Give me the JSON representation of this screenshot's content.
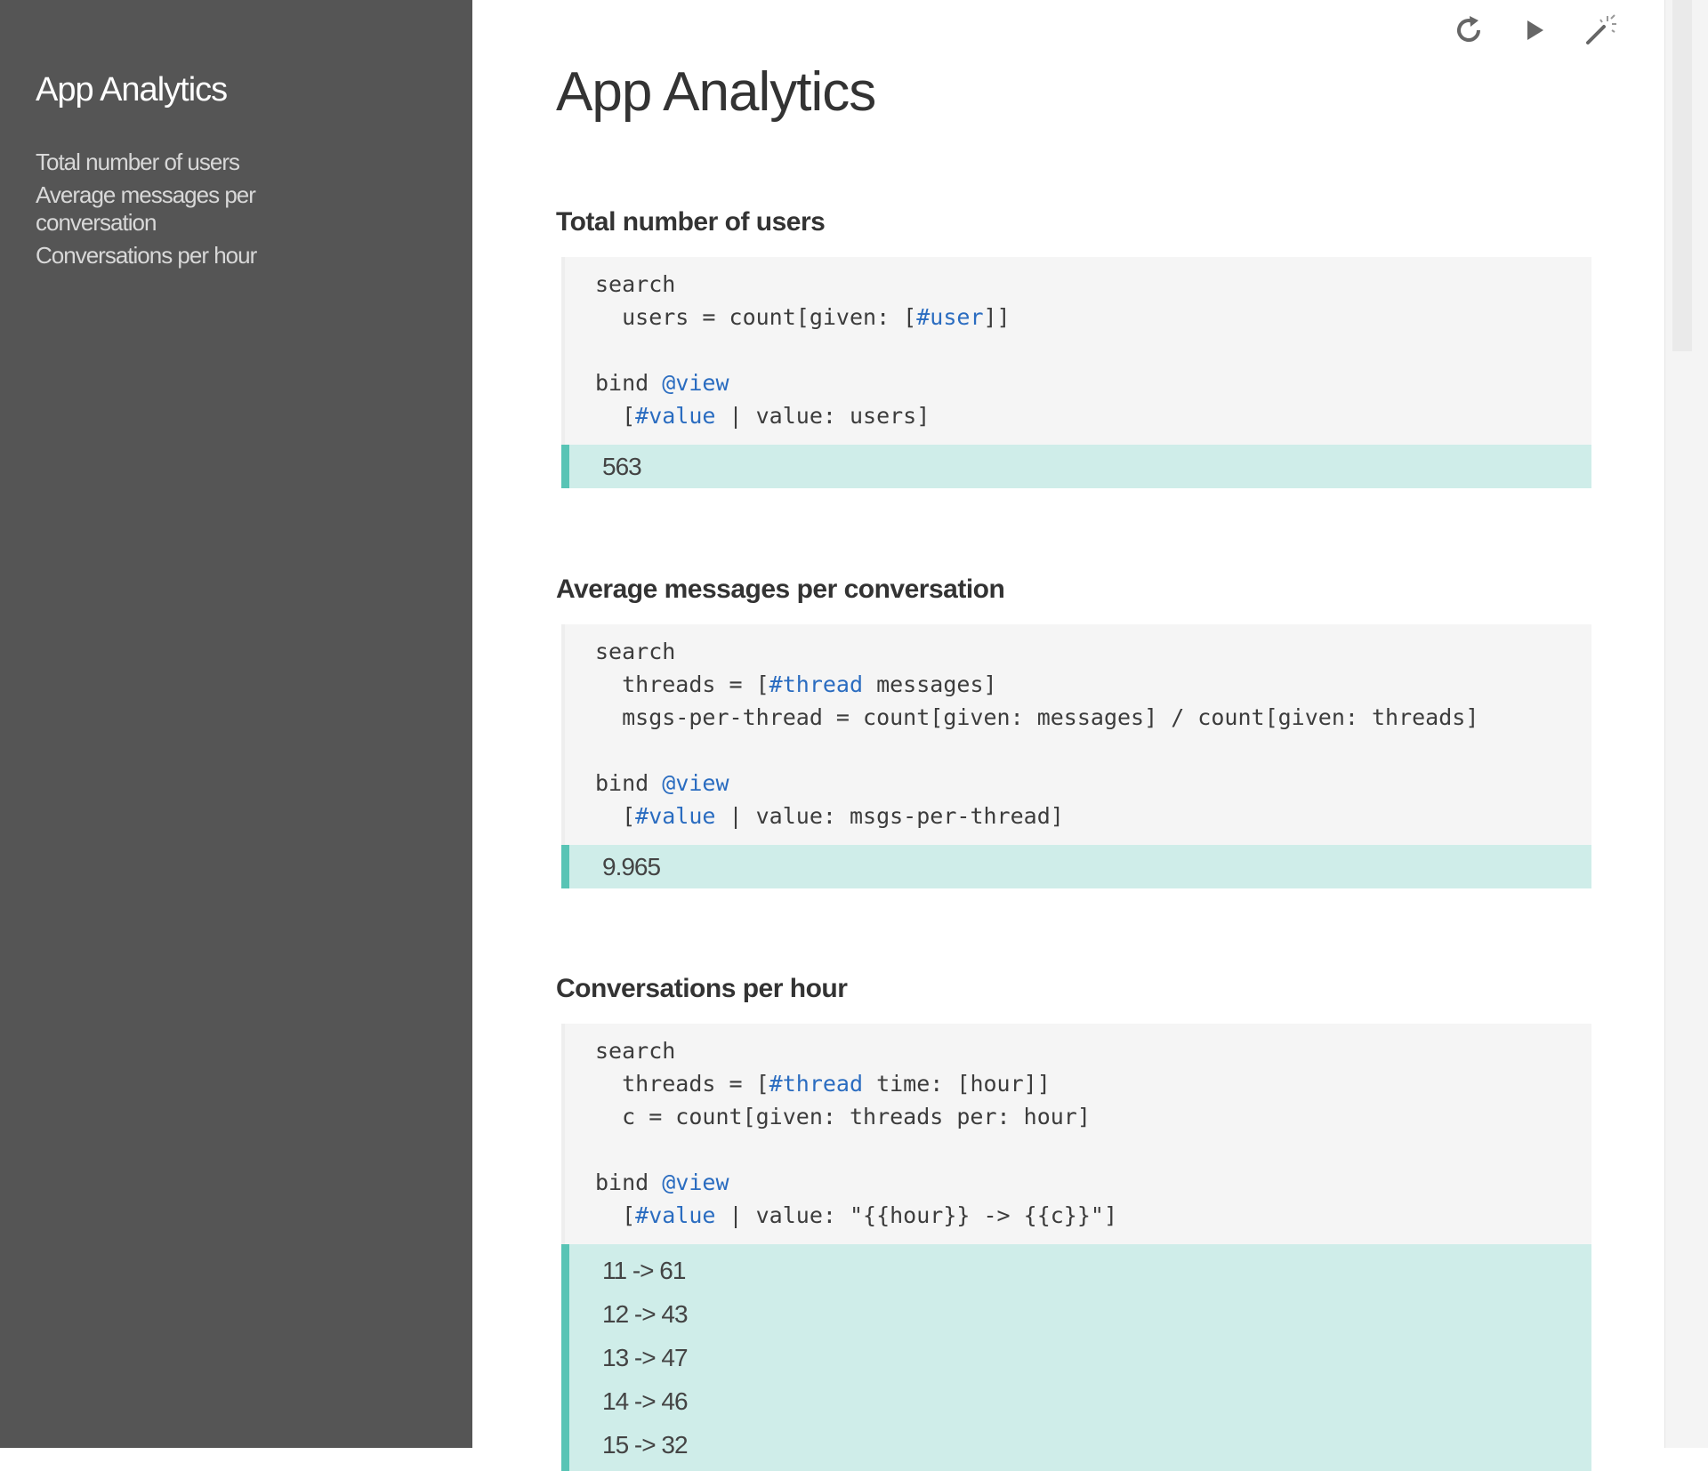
{
  "sidebar": {
    "title": "App Analytics",
    "items": [
      {
        "label": "Total number of users"
      },
      {
        "label": "Average messages per conversation"
      },
      {
        "label": "Conversations per hour"
      }
    ]
  },
  "toolbar": {
    "icons": [
      "refresh-icon",
      "play-icon",
      "magic-wand-icon"
    ]
  },
  "page": {
    "title": "App Analytics"
  },
  "blocks": [
    {
      "title": "Total number of users",
      "code": {
        "l1": "search",
        "l2a": "  users = count[given: [",
        "l2tag": "#user",
        "l2b": "]]",
        "l3": "bind ",
        "l3tag": "@view",
        "l4a": "  [",
        "l4tag": "#value",
        "l4b": " | value: users]"
      },
      "results": [
        "563"
      ]
    },
    {
      "title": "Average messages per conversation",
      "code": {
        "l1": "search",
        "l2a": "  threads = [",
        "l2tag": "#thread",
        "l2b": " messages]",
        "l2c": "  msgs-per-thread = count[given: messages] / count[given: threads]",
        "l3": "bind ",
        "l3tag": "@view",
        "l4a": "  [",
        "l4tag": "#value",
        "l4b": " | value: msgs-per-thread]"
      },
      "results": [
        "9.965"
      ]
    },
    {
      "title": "Conversations per hour",
      "code": {
        "l1": "search",
        "l2a": "  threads = [",
        "l2tag": "#thread",
        "l2b": " time: [hour]]",
        "l2c": "  c = count[given: threads per: hour]",
        "l3": "bind ",
        "l3tag": "@view",
        "l4a": "  [",
        "l4tag": "#value",
        "l4b": " | value: \"{{hour}} -> {{c}}\"]"
      },
      "results": [
        "11 -> 61",
        "12 -> 43",
        "13 -> 47",
        "14 -> 46",
        "15 -> 32"
      ]
    }
  ]
}
